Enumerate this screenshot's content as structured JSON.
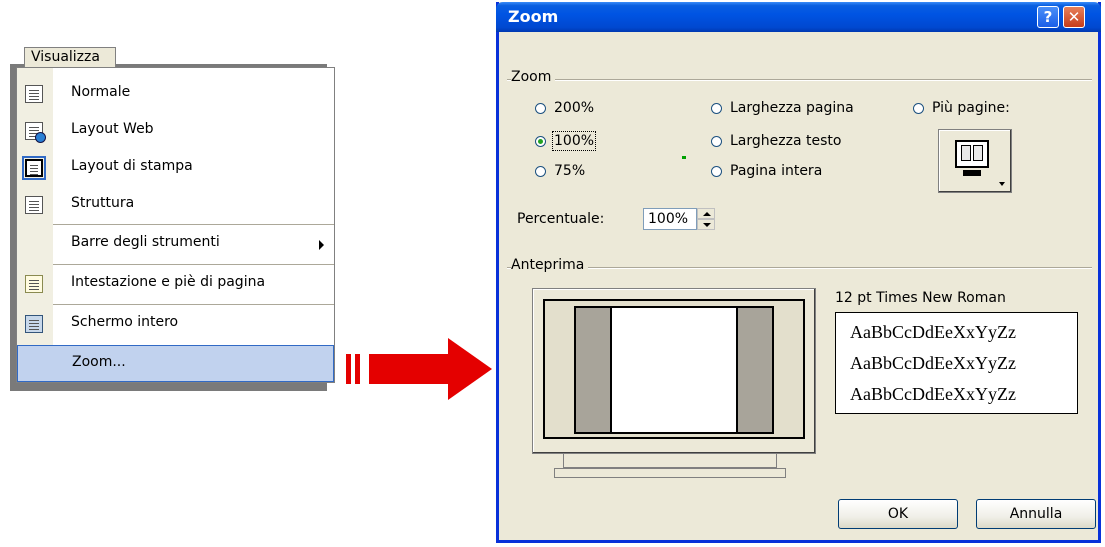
{
  "menu": {
    "title": "Visualizza",
    "items": [
      {
        "label": "Normale",
        "icon": "normal-view-icon"
      },
      {
        "label": "Layout Web",
        "icon": "web-layout-icon"
      },
      {
        "label": "Layout di stampa",
        "icon": "print-layout-icon"
      },
      {
        "label": "Struttura",
        "icon": "outline-icon"
      },
      {
        "label": "Barre degli strumenti",
        "icon": "submenu-arrow-icon"
      },
      {
        "label": "Intestazione e piè di pagina",
        "icon": "header-footer-icon"
      },
      {
        "label": "Schermo intero",
        "icon": "full-screen-icon"
      },
      {
        "label": "Zoom..."
      }
    ]
  },
  "dialog": {
    "title": "Zoom",
    "help_glyph": "?",
    "close_glyph": "✕",
    "zoom_group": "Zoom",
    "options": {
      "z200": "200%",
      "z100": "100%",
      "z75": "75%",
      "page_width": "Larghezza pagina",
      "text_width": "Larghezza testo",
      "whole_page": "Pagina intera",
      "many_pages": "Più pagine:"
    },
    "selected": "100%",
    "percent_label": "Percentuale:",
    "percent_value": "100%",
    "preview_group": "Anteprima",
    "font_caption": "12 pt Times New Roman",
    "sample_lines": [
      "AaBbCcDdEeXxYyZz",
      "AaBbCcDdEeXxYyZz",
      "AaBbCcDdEeXxYyZz"
    ],
    "ok": "OK",
    "cancel": "Annulla"
  },
  "colors": {
    "arrow": "#e40000",
    "titlebar": "#0054e3",
    "dialog_bg": "#ece9d8",
    "menu_highlight": "#c1d2ee"
  }
}
